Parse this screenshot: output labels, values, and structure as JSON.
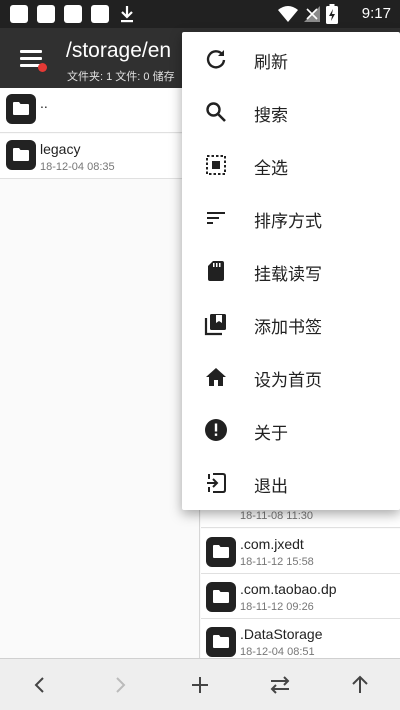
{
  "status_bar": {
    "time": "9:17",
    "icons": [
      "notification-icon",
      "notification-icon",
      "notification-icon",
      "notification-icon",
      "download-icon",
      "wifi-icon",
      "no-signal-icon",
      "battery-charging-icon"
    ]
  },
  "app_bar": {
    "path": "/storage/en",
    "subtitle": "文件夹: 1  文件: 0  储存"
  },
  "left_list": [
    {
      "name": "..",
      "date": ""
    },
    {
      "name": "legacy",
      "date": "18-12-04 08:35"
    }
  ],
  "right_list": [
    {
      "name": "",
      "date": "18-11-08 11:30"
    },
    {
      "name": ".com.jxedt",
      "date": "18-11-12 15:58"
    },
    {
      "name": ".com.taobao.dp",
      "date": "18-11-12 09:26"
    },
    {
      "name": ".DataStorage",
      "date": "18-12-04 08:51"
    }
  ],
  "menu": {
    "items": [
      {
        "label": "刷新",
        "icon": "refresh-icon"
      },
      {
        "label": "搜索",
        "icon": "search-icon"
      },
      {
        "label": "全选",
        "icon": "select-all-icon"
      },
      {
        "label": "排序方式",
        "icon": "sort-icon"
      },
      {
        "label": "挂载读写",
        "icon": "sd-card-icon"
      },
      {
        "label": "添加书签",
        "icon": "bookmark-icon"
      },
      {
        "label": "设为首页",
        "icon": "home-icon"
      },
      {
        "label": "关于",
        "icon": "info-icon"
      },
      {
        "label": "退出",
        "icon": "exit-icon"
      }
    ]
  },
  "bottom_bar": {
    "buttons": [
      "back-icon",
      "forward-icon",
      "add-icon",
      "swap-icon",
      "up-icon"
    ]
  },
  "colors": {
    "app_bar": "#303030",
    "status_bar": "#212121",
    "badge": "#e53935"
  }
}
